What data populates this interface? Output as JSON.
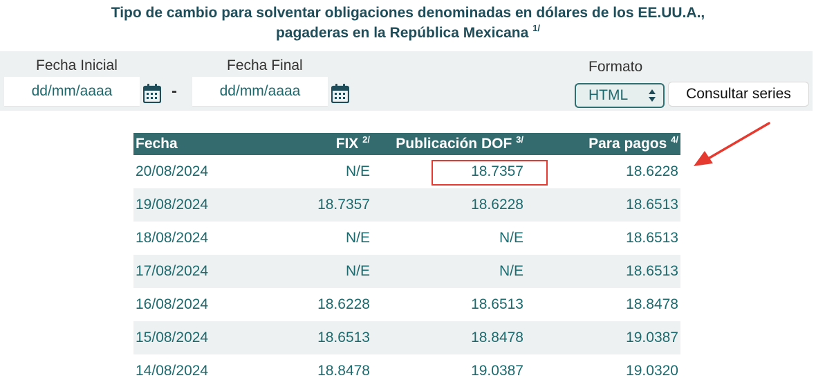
{
  "title": {
    "line1": "Tipo de cambio para solventar obligaciones denominadas en dólares de los EE.UU.A.,",
    "line2": "pagaderas en la República Mexicana",
    "note": "1/"
  },
  "filters": {
    "start_label": "Fecha Inicial",
    "start_placeholder": "dd/mm/aaaa",
    "separator": "-",
    "end_label": "Fecha Final",
    "end_placeholder": "dd/mm/aaaa",
    "format_label": "Formato",
    "format_value": "HTML",
    "submit_label": "Consultar series"
  },
  "table": {
    "headers": [
      {
        "label": "Fecha",
        "note": ""
      },
      {
        "label": "FIX",
        "note": "2/"
      },
      {
        "label": "Publicación DOF",
        "note": "3/"
      },
      {
        "label": "Para pagos",
        "note": "4/"
      }
    ],
    "rows": [
      [
        "20/08/2024",
        "N/E",
        "18.7357",
        "18.6228"
      ],
      [
        "19/08/2024",
        "18.7357",
        "18.6228",
        "18.6513"
      ],
      [
        "18/08/2024",
        "N/E",
        "N/E",
        "18.6513"
      ],
      [
        "17/08/2024",
        "N/E",
        "N/E",
        "18.6513"
      ],
      [
        "16/08/2024",
        "18.6228",
        "18.6513",
        "18.8478"
      ],
      [
        "15/08/2024",
        "18.6513",
        "18.8478",
        "19.0387"
      ],
      [
        "14/08/2024",
        "18.8478",
        "19.0387",
        "19.0320"
      ]
    ]
  },
  "annotation": {
    "color": "#e53a2f"
  }
}
